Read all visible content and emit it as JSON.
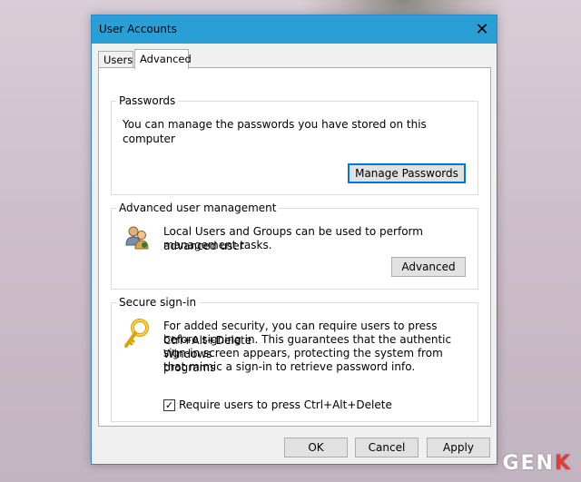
{
  "window": {
    "title": "User Accounts",
    "close_glyph": "✕"
  },
  "tabs": [
    {
      "label": "Users",
      "selected": false
    },
    {
      "label": "Advanced",
      "selected": true
    }
  ],
  "passwords": {
    "legend": "Passwords",
    "description": "You can manage the passwords you have stored on this computer",
    "button": "Manage Passwords"
  },
  "advanced_mgmt": {
    "legend": "Advanced user management",
    "description_line1": "Local Users and Groups can be used to perform advanced user",
    "description_line2": "management tasks.",
    "button": "Advanced",
    "icon": "users-group-icon"
  },
  "secure_signin": {
    "legend": "Secure sign-in",
    "lines": [
      "For added security, you can require users to press Ctrl+Alt+Delete",
      "before signing in. This guarantees that the authentic Windows",
      "sign-in screen appears, protecting the system from programs",
      "that mimic a sign-in to retrieve password info."
    ],
    "checkbox_label": "Require users to press Ctrl+Alt+Delete",
    "checkbox_checked": true,
    "icon": "key-icon"
  },
  "footer": {
    "ok": "OK",
    "cancel": "Cancel",
    "apply": "Apply"
  },
  "watermark": {
    "text_main": "GEN",
    "text_accent": "K"
  },
  "colors": {
    "titlebar": "#2a9fd6",
    "focus_border": "#0078d7"
  }
}
